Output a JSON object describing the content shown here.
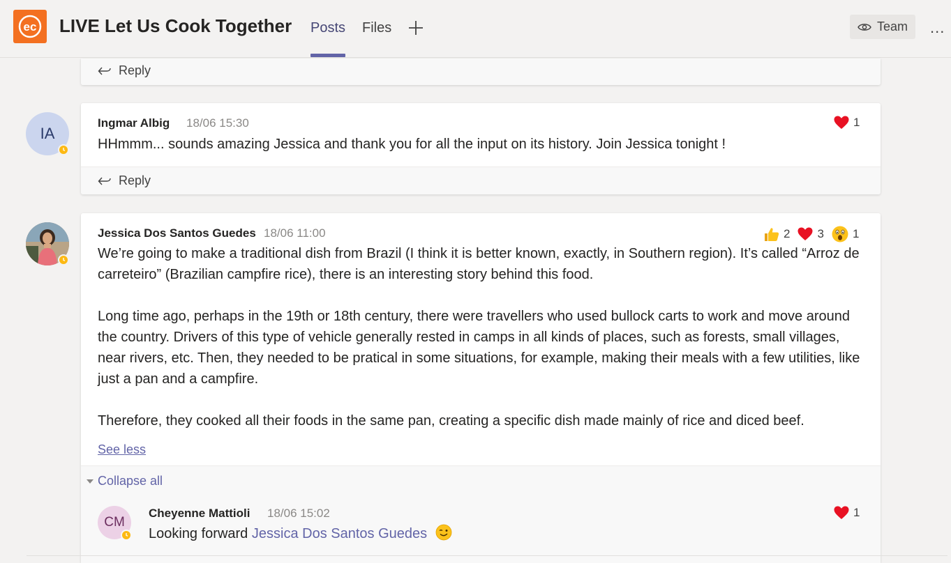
{
  "header": {
    "title": "LIVE Let Us Cook Together",
    "logo_text": "ec",
    "tabs": [
      {
        "label": "Posts",
        "active": true
      },
      {
        "label": "Files",
        "active": false
      }
    ],
    "team_label": "Team",
    "more_label": "..."
  },
  "top_card": {
    "reply_label": "Reply"
  },
  "post1": {
    "avatar_initials": "IA",
    "author": "Ingmar Albig",
    "time": "18/06 15:30",
    "message": "HHmmm... sounds amazing Jessica and thank you for all the input on its history. Join Jessica tonight !",
    "reactions": [
      {
        "icon": "heart-icon",
        "count": "1"
      }
    ],
    "reply_label": "Reply"
  },
  "post2": {
    "author": "Jessica Dos Santos Guedes",
    "time": "18/06 11:00",
    "paragraphs": [
      "We’re going to make a traditional dish from Brazil (I think it is better known, exactly, in Southern region). It’s called “Arroz de carreteiro” (Brazilian campfire rice), there is an interesting story behind this food.",
      "Long time ago, perhaps in the 19th or 18th century, there were travellers who used bullock carts to work and move around the country. Drivers of this type of vehicle generally rested in camps in all kinds of places, such as forests, small villages, near rivers, etc. Then, they needed to be pratical in some situations, for example, making their meals with a few utilities, like just a pan and a campfire.",
      "Therefore, they cooked all their foods in the same pan, creating a specific dish made mainly of rice and diced beef."
    ],
    "see_less": "See less",
    "collapse_all": "Collapse all",
    "reactions": [
      {
        "icon": "thumbs-up-icon",
        "count": "2"
      },
      {
        "icon": "heart-icon",
        "count": "3"
      },
      {
        "icon": "surprised-icon",
        "count": "1"
      }
    ],
    "reply": {
      "avatar_initials": "CM",
      "author": "Cheyenne Mattioli",
      "time": "18/06 15:02",
      "message_prefix": "Looking forward ",
      "mention": "Jessica Dos Santos Guedes",
      "reactions": [
        {
          "icon": "heart-icon",
          "count": "1"
        }
      ]
    }
  },
  "colors": {
    "accent": "#6264a7",
    "logo": "#f37021",
    "heart": "#e81123",
    "status_away": "#fdb913"
  }
}
